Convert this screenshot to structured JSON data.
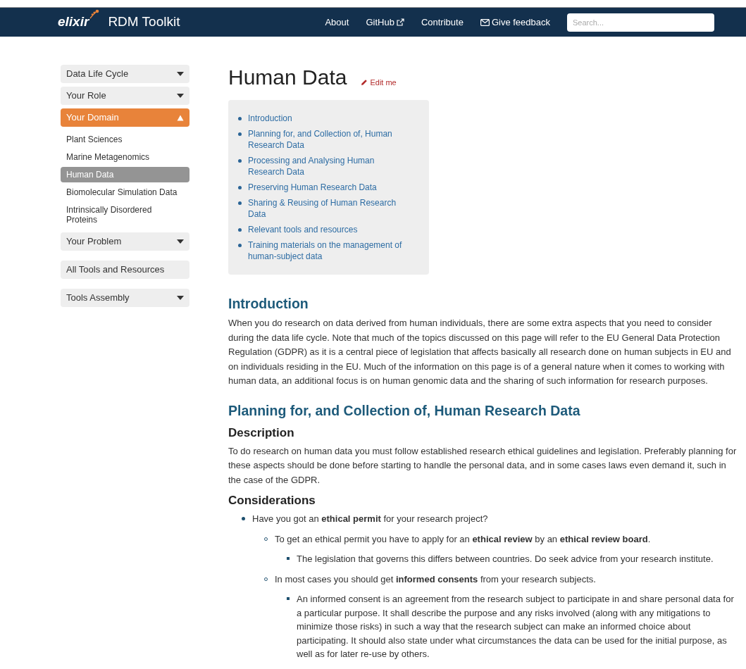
{
  "navbar": {
    "logo_text": "elixir",
    "title": "RDM Toolkit",
    "links": [
      {
        "label": "About",
        "kind": "plain"
      },
      {
        "label": "GitHub",
        "kind": "external"
      },
      {
        "label": "Contribute",
        "kind": "plain"
      },
      {
        "label": "Give feedback",
        "kind": "mail"
      }
    ],
    "search": {
      "placeholder": "Search..."
    }
  },
  "sidebar": {
    "groups": [
      [
        {
          "label": "Data Life Cycle",
          "expanded": false
        },
        {
          "label": "Your Role",
          "expanded": false
        },
        {
          "label": "Your Domain",
          "expanded": true,
          "children": [
            {
              "label": "Plant Sciences",
              "selected": false
            },
            {
              "label": "Marine Metagenomics",
              "selected": false
            },
            {
              "label": "Human Data",
              "selected": true
            },
            {
              "label": "Biomolecular Simulation Data",
              "selected": false
            },
            {
              "label": "Intrinsically Disordered Proteins",
              "selected": false
            }
          ]
        },
        {
          "label": "Your Problem",
          "expanded": false
        }
      ],
      [
        {
          "label": "All Tools and Resources"
        }
      ],
      [
        {
          "label": "Tools Assembly",
          "expanded": false
        }
      ]
    ]
  },
  "page": {
    "title": "Human Data",
    "edit_link": "Edit me",
    "toc": [
      "Introduction",
      "Planning for, and Collection of, Human Research Data",
      "Processing and Analysing Human Research Data",
      "Preserving Human Research Data",
      "Sharing & Reusing of Human Research Data",
      "Relevant tools and resources",
      "Training materials on the management of human-subject data"
    ],
    "blocks": [
      {
        "kind": "h2",
        "text": "Introduction"
      },
      {
        "kind": "p",
        "text": "When you do research on data derived from human individuals, there are some extra aspects that you need to consider during the data life cycle. Note that much of the topics discussed on this page will refer to the EU General Data Protection Regulation (GDPR) as it is a central piece of legislation that affects basically all research done on human subjects in EU and on individuals residing in the EU. Much of the information on this page is of a general nature when it comes to working with human data, an additional focus is on human genomic data and the sharing of such information for research purposes."
      },
      {
        "kind": "h2",
        "text": "Planning for, and Collection of, Human Research Data"
      },
      {
        "kind": "h3",
        "text": "Description"
      },
      {
        "kind": "p",
        "text": "To do research on human data you must follow established research ethical guidelines and legislation. Preferably planning for these aspects should be done before starting to handle the personal data, and in some cases laws even demand it, such in the case of the GDPR."
      },
      {
        "kind": "h3",
        "text": "Considerations"
      },
      {
        "kind": "ul",
        "items": [
          {
            "text": "Have you got an **ethical permit** for your research project?",
            "children": [
              {
                "text": "To get an ethical permit you have to apply for an **ethical review** by an **ethical review board**.",
                "children": [
                  {
                    "text": "The legislation that governs this differs between countries. Do seek advice from your research institute."
                  }
                ]
              },
              {
                "text": "In most cases you should get **informed consents** from your research subjects.",
                "children": [
                  {
                    "text": "An informed consent is an agreement from the research subject to participate in and share personal data for a particular purpose. It shall describe the purpose and any risks involved (along with any mitigations to minimize those risks) in such a way that the research subject can make an informed choice about participating. It should also state under what circumstances the data can be used for the initial purpose, as well as for later re-use by others."
                  }
                ]
              }
            ]
          }
        ]
      }
    ]
  }
}
